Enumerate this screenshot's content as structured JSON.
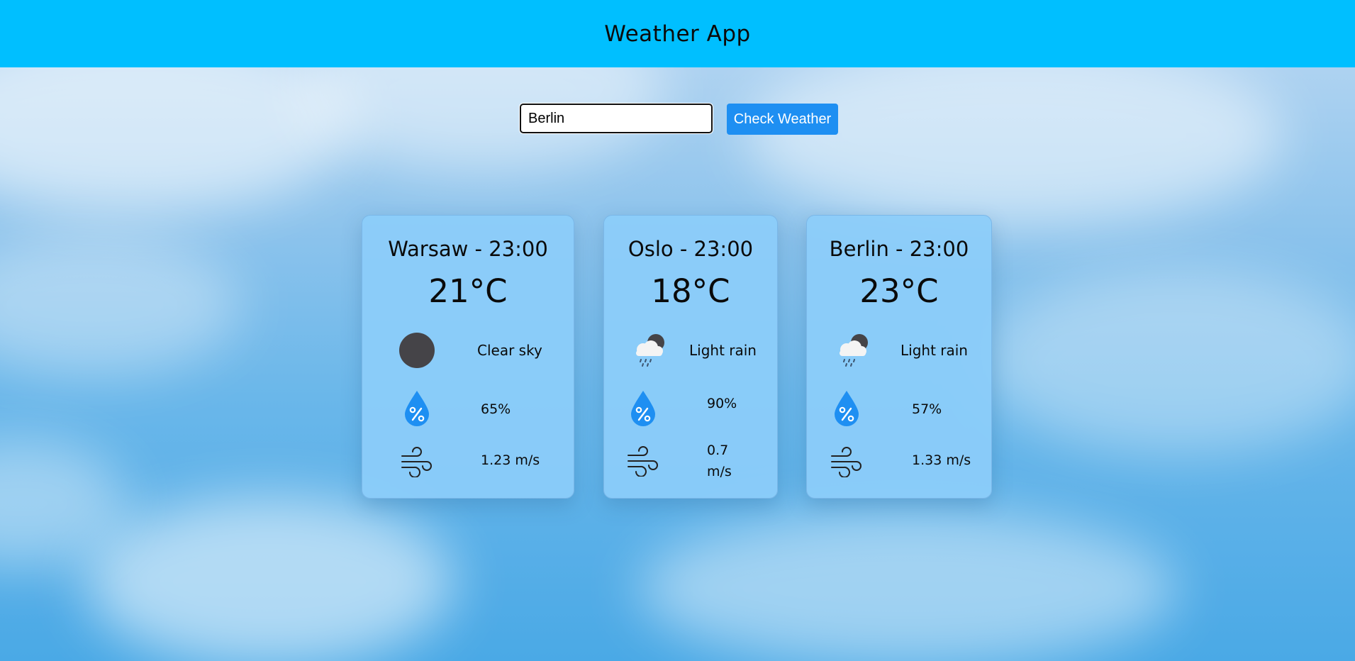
{
  "header": {
    "title": "Weather App"
  },
  "search": {
    "value": "Berlin",
    "button_label": "Check Weather"
  },
  "cards": [
    {
      "city": "Warsaw - 23:00",
      "temp": "21°C",
      "condition": "Clear sky",
      "condition_icon": "night-clear-icon",
      "humidity": "65%",
      "wind": "1.23 m/s"
    },
    {
      "city": "Oslo - 23:00",
      "temp": "18°C",
      "condition": "Light rain",
      "condition_icon": "night-rain-icon",
      "humidity": "90%",
      "wind": "0.7 m/s"
    },
    {
      "city": "Berlin - 23:00",
      "temp": "23°C",
      "condition": "Light rain",
      "condition_icon": "night-rain-icon",
      "humidity": "57%",
      "wind": "1.33 m/s"
    }
  ],
  "colors": {
    "header": "#00bfff",
    "button": "#1e8ff2",
    "card": "#8ccdfa",
    "icon_blue": "#1e8ff2"
  }
}
